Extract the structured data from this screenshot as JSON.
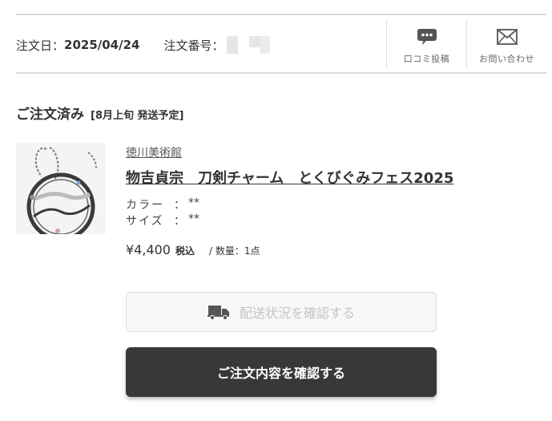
{
  "order": {
    "date_label": "注文日：",
    "date_value": "2025/04/24",
    "number_label": "注文番号："
  },
  "actions": {
    "review_label": "口コミ投稿",
    "contact_label": "お問い合わせ"
  },
  "status": {
    "main": "ご注文済み",
    "sub": "[8月上旬 発送予定]"
  },
  "item": {
    "shop": "徳川美術館",
    "name": "物吉貞宗　刀剣チャーム　とくびぐみフェス2025",
    "color_label": "カラー",
    "color_value": "**",
    "size_label": "サイズ",
    "size_value": "**",
    "price": "¥4,400",
    "tax": "税込",
    "quantity": "/ 数量：1点"
  },
  "buttons": {
    "track": "配送状況を確認する",
    "detail": "ご注文内容を確認する"
  }
}
